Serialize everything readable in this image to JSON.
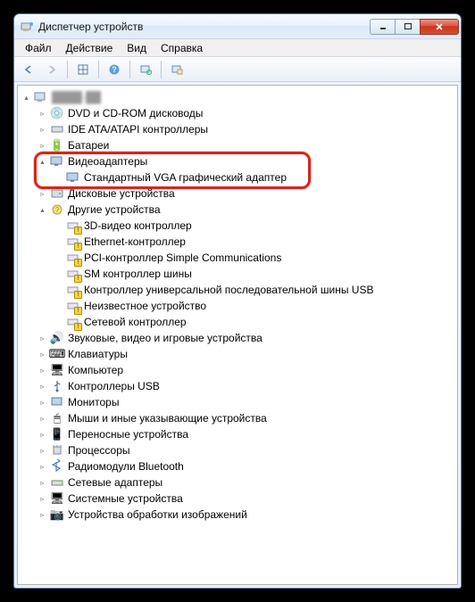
{
  "window": {
    "title": "Диспетчер устройств"
  },
  "menu": {
    "file": "Файл",
    "action": "Действие",
    "view": "Вид",
    "help": "Справка"
  },
  "tree": {
    "root": "████-██",
    "dvd": "DVD и CD-ROM дисководы",
    "ide": "IDE ATA/ATAPI контроллеры",
    "battery": "Батареи",
    "video_adapters": "Видеоадаптеры",
    "vga_adapter": "Стандартный VGA графический адаптер",
    "disk": "Дисковые устройства",
    "other": "Другие устройства",
    "other_items": {
      "v3d": "3D-видео контроллер",
      "eth": "Ethernet-контроллер",
      "pci": "PCI-контроллер Simple Communications",
      "sm": "SM контроллер шины",
      "usb": "Контроллер универсальной последовательной шины USB",
      "unknown": "Неизвестное устройство",
      "net": "Сетевой контроллер"
    },
    "sound": "Звуковые, видео и игровые устройства",
    "keyboard": "Клавиатуры",
    "computer": "Компьютер",
    "usb_ctrl": "Контроллеры USB",
    "monitor": "Мониторы",
    "mouse": "Мыши и иные указывающие устройства",
    "portable": "Переносные устройства",
    "cpu": "Процессоры",
    "bt": "Радиомодули Bluetooth",
    "netadapter": "Сетевые адаптеры",
    "system": "Системные устройства",
    "imaging": "Устройства обработки изображений"
  }
}
